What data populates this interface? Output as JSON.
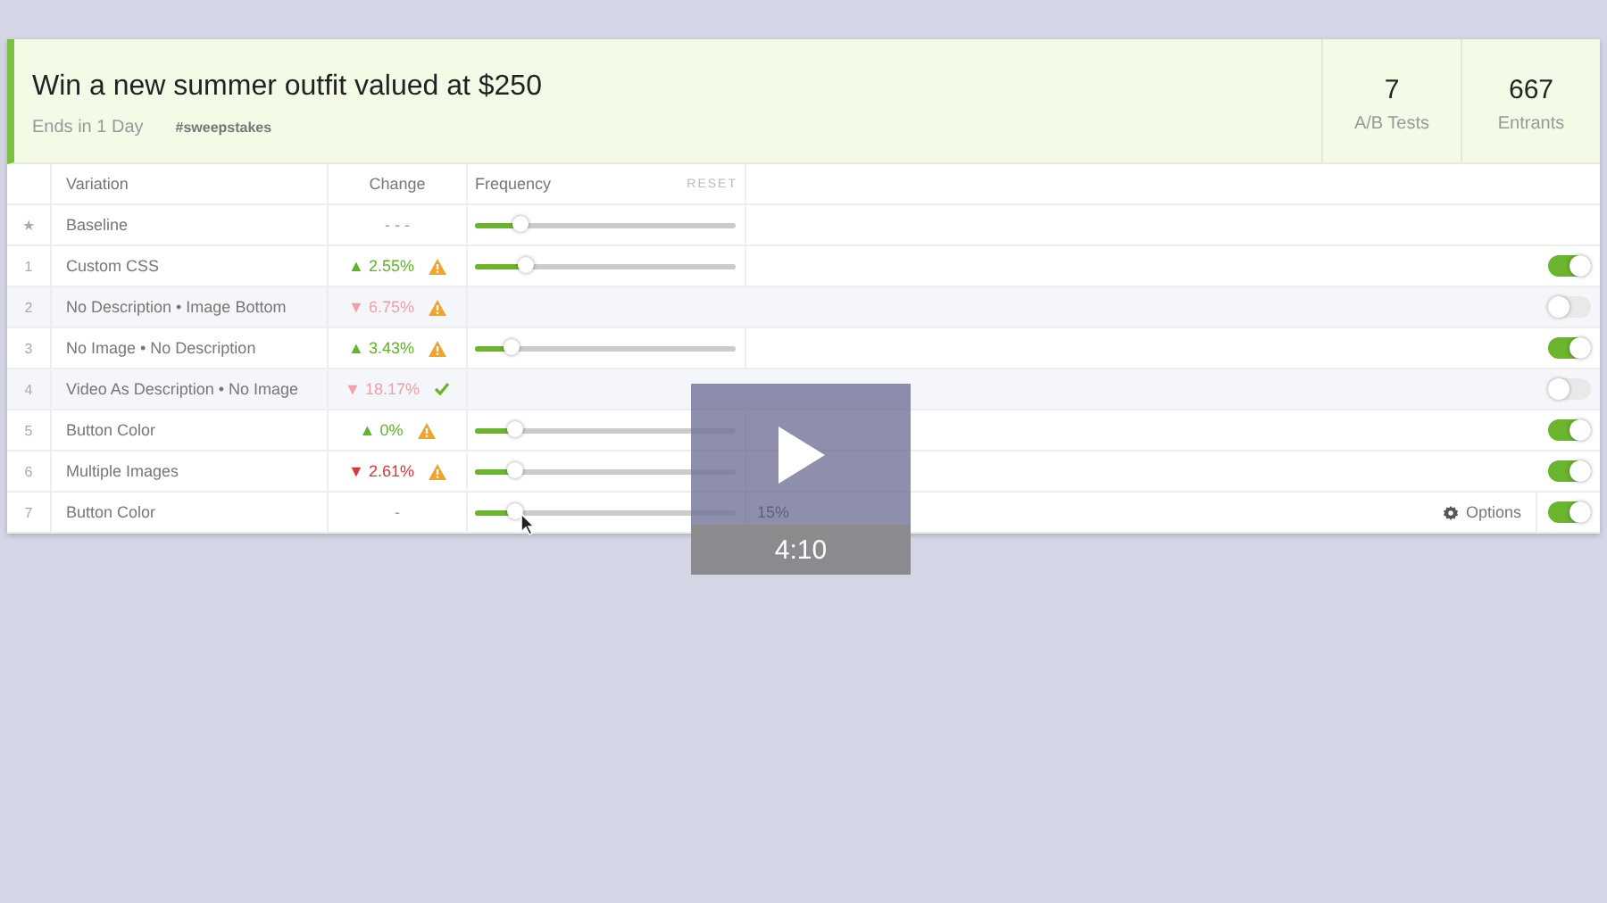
{
  "campaign": {
    "title": "Win a new summer outfit valued at $250",
    "ends": "Ends in 1 Day",
    "tag": "#sweepstakes"
  },
  "stats": [
    {
      "value": "7",
      "label": "A/B Tests"
    },
    {
      "value": "667",
      "label": "Entrants"
    }
  ],
  "columns": {
    "variation": "Variation",
    "change": "Change",
    "frequency": "Frequency",
    "reset": "RESET"
  },
  "rows": [
    {
      "index": "★",
      "name": "Baseline",
      "change": "- - -",
      "color": "#999999",
      "kind": "plain",
      "level": 0.17
    },
    {
      "index": "1",
      "name": "Custom CSS",
      "change": "▲ 2.55%",
      "color": "#5fb52a",
      "kind": "warning",
      "on": true,
      "level": 0.19
    },
    {
      "index": "2",
      "name": "No Description • Image Bottom",
      "change": "▼ 6.75%",
      "color": "#f0a0a8",
      "kind": "warning",
      "on": false
    },
    {
      "index": "3",
      "name": "No Image • No Description",
      "change": "▲ 3.43%",
      "color": "#5fb52a",
      "kind": "warning",
      "on": true,
      "level": 0.14
    },
    {
      "index": "4",
      "name": "Video As Description • No Image",
      "change": "▼ 18.17%",
      "color": "#f0a0a8",
      "kind": "check",
      "on": false
    },
    {
      "index": "5",
      "name": "Button Color",
      "change": "▲ 0%",
      "color": "#5fb52a",
      "kind": "warning",
      "on": true,
      "level": 0.15
    },
    {
      "index": "6",
      "name": "Multiple Images",
      "change": "▼ 2.61%",
      "color": "#d9363e",
      "kind": "warning",
      "on": true,
      "level": 0.15
    },
    {
      "index": "7",
      "name": "Button Color",
      "change": "-",
      "color": "#999999",
      "kind": "plain",
      "on": true,
      "level": 0.15,
      "reading": "15%",
      "options": "Options"
    }
  ],
  "video": {
    "duration": "4:10"
  }
}
